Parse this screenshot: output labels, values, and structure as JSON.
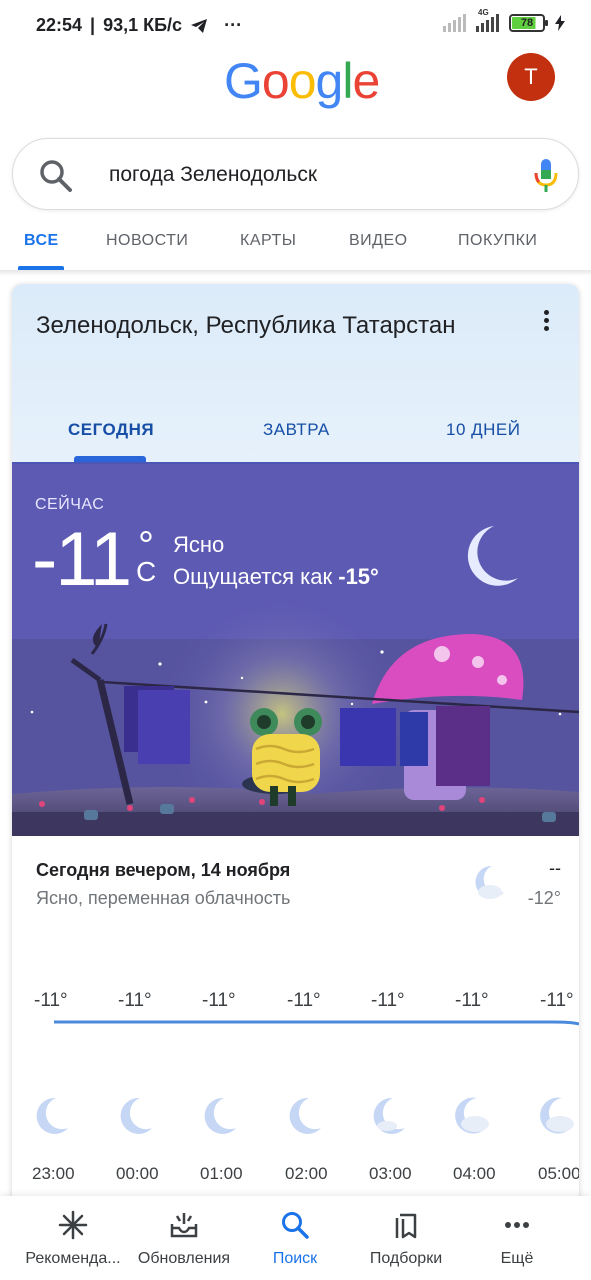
{
  "status_bar": {
    "time": "22:54",
    "speed": "93,1 КБ/с",
    "dots": "···",
    "network": "4G",
    "battery": "78"
  },
  "header": {
    "logo_letters": [
      "G",
      "o",
      "o",
      "g",
      "l",
      "e"
    ],
    "avatar_letter": "T",
    "avatar_color": "#c2300f"
  },
  "search": {
    "query": "погода Зеленодольск"
  },
  "tabs": {
    "items": [
      "ВСЕ",
      "НОВОСТИ",
      "КАРТЫ",
      "ВИДЕО",
      "ПОКУПКИ"
    ],
    "active": "ВСЕ"
  },
  "weather": {
    "location": "Зеленодольск, Республика Татарстан",
    "tabs": [
      "СЕГОДНЯ",
      "ЗАВТРА",
      "10 ДНЕЙ"
    ],
    "active_tab": "СЕГОДНЯ",
    "now_label": "СЕЙЧАС",
    "temperature": "-11",
    "degree_symbol": "°",
    "unit": "C",
    "condition": "Ясно",
    "feels_like_label": "Ощущается как ",
    "feels_like_value": "-15°",
    "scene_bg": "#5d5ab3",
    "tonight": {
      "title": "Сегодня вечером, 14 ноября",
      "description": "Ясно, переменная облачность",
      "high": "--",
      "low": "-12°",
      "icon": "moon-cloud-icon"
    },
    "hourly": [
      {
        "time": "23:00",
        "temp": "-11°",
        "icon": "moon-icon"
      },
      {
        "time": "00:00",
        "temp": "-11°",
        "icon": "moon-icon"
      },
      {
        "time": "01:00",
        "temp": "-11°",
        "icon": "moon-icon"
      },
      {
        "time": "02:00",
        "temp": "-11°",
        "icon": "moon-icon"
      },
      {
        "time": "03:00",
        "temp": "-11°",
        "icon": "moon-cloud-icon"
      },
      {
        "time": "04:00",
        "temp": "-11°",
        "icon": "moon-cloud-icon"
      },
      {
        "time": "05:00",
        "temp": "-11°",
        "icon": "moon-cloud-icon"
      }
    ]
  },
  "bottom_nav": {
    "items": [
      {
        "label": "Рекоменда...",
        "icon": "asterisk-icon"
      },
      {
        "label": "Обновления",
        "icon": "updates-icon"
      },
      {
        "label": "Поиск",
        "icon": "search-icon"
      },
      {
        "label": "Подборки",
        "icon": "collections-icon"
      },
      {
        "label": "Ещё",
        "icon": "more-icon"
      }
    ],
    "active": "Поиск",
    "accent": "#1a73e8"
  }
}
